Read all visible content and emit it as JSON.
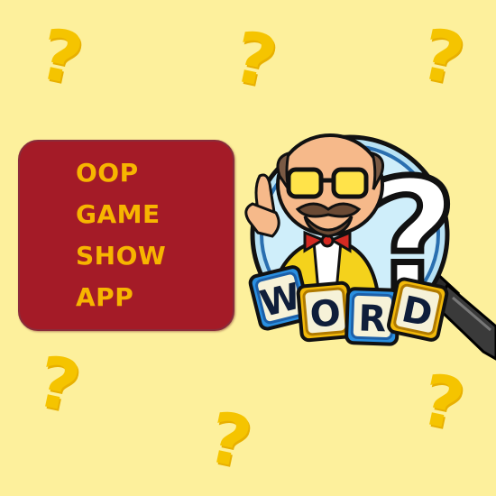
{
  "background_color": "#fdf09c",
  "title_card": {
    "lines": [
      "OOP",
      "GAME",
      "SHOW",
      "APP"
    ],
    "background_color": "#a41b27",
    "text_color": "#f7b500"
  },
  "decorations": {
    "question_mark": "?",
    "icon": "question-mark-icon",
    "color": "#f5c400"
  },
  "logo": {
    "icon": "professor-magnifier-logo",
    "letters": [
      "W",
      "O",
      "R",
      "D"
    ],
    "big_question_mark": "?"
  }
}
